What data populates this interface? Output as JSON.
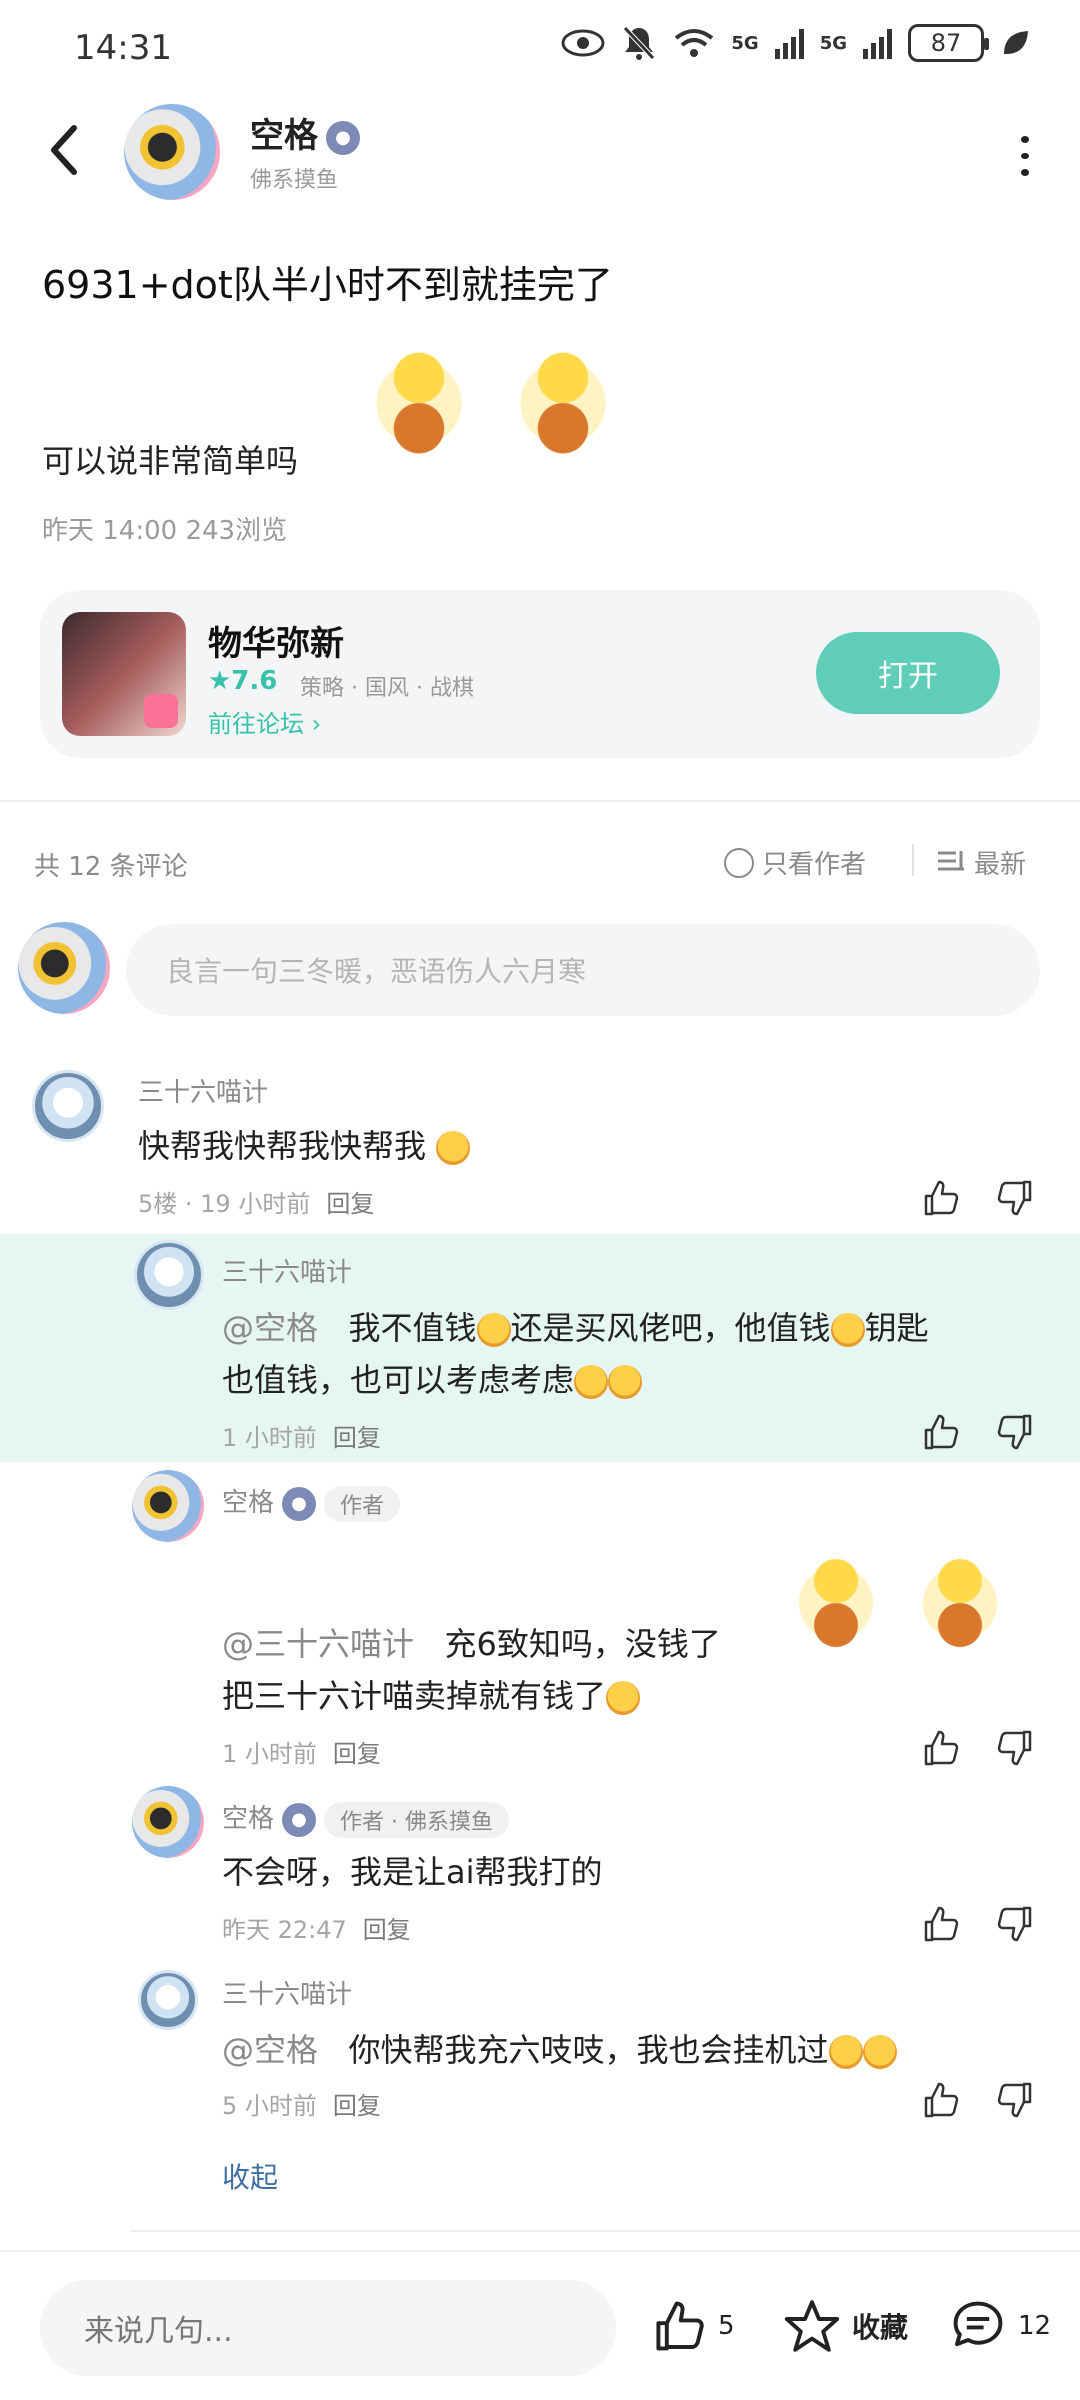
{
  "status_bar": {
    "time": "14:31",
    "net1": "5G",
    "net2": "5G",
    "battery": "87"
  },
  "header": {
    "username": "空格",
    "subtitle": "佛系摸鱼"
  },
  "post": {
    "title": "6931+dot队半小时不到就挂完了",
    "body": "可以说非常简单吗",
    "meta": "昨天 14:00   243浏览"
  },
  "game_card": {
    "name": "物华弥新",
    "rating": "★7.6",
    "tags": "策略 · 国风 · 战棋",
    "forum_link": "前往论坛 ›",
    "open_button": "打开"
  },
  "comments_header": {
    "count_text": "共  12  条评论",
    "only_author": "只看作者",
    "sort": "最新"
  },
  "comment_input": {
    "placeholder": "良言一句三冬暖，恶语伤人六月寒"
  },
  "comments": [
    {
      "name": "三十六喵计",
      "text": "快帮我快帮我快帮我",
      "meta": "5楼  ·  19 小时前",
      "reply": "回复"
    },
    {
      "name": "三十六喵计",
      "mention": "@空格",
      "text_line1": "我不值钱",
      "text_line1b": "还是买风佬吧，他值钱",
      "text_line1c": "钥匙",
      "text_line2": "也值钱，也可以考虑考虑",
      "meta": "1 小时前",
      "reply": "回复"
    },
    {
      "name": "空格",
      "tag": "作者",
      "mention": "@三十六喵计",
      "text_line1": "充6致知吗，没钱了",
      "text_line2": "把三十六计喵卖掉就有钱了",
      "meta": "1 小时前",
      "reply": "回复"
    },
    {
      "name": "空格",
      "tag": "作者 · 佛系摸鱼",
      "text": "不会呀，我是让ai帮我打的",
      "meta": "昨天 22:47",
      "reply": "回复"
    },
    {
      "name": "三十六喵计",
      "mention": "@空格",
      "text": "你快帮我充六吱吱，我也会挂机过",
      "meta": "5 小时前",
      "reply": "回复"
    }
  ],
  "collapse": "收起",
  "bottom_bar": {
    "say_placeholder": "来说几句...",
    "likes": "5",
    "favorite": "收藏",
    "comments": "12"
  }
}
